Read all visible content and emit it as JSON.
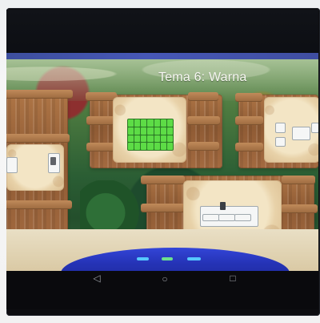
{
  "screen": {
    "title": "Tema 6: Warna"
  },
  "navigation": {
    "back_icon": "back-triangle",
    "home_icon": "home-circle",
    "recent_icon": "recent-square"
  },
  "tiles": [
    {
      "name": "left-partial-panel"
    },
    {
      "name": "green-grid-activity"
    },
    {
      "name": "picture-activity"
    },
    {
      "name": "quiz-activity"
    }
  ]
}
